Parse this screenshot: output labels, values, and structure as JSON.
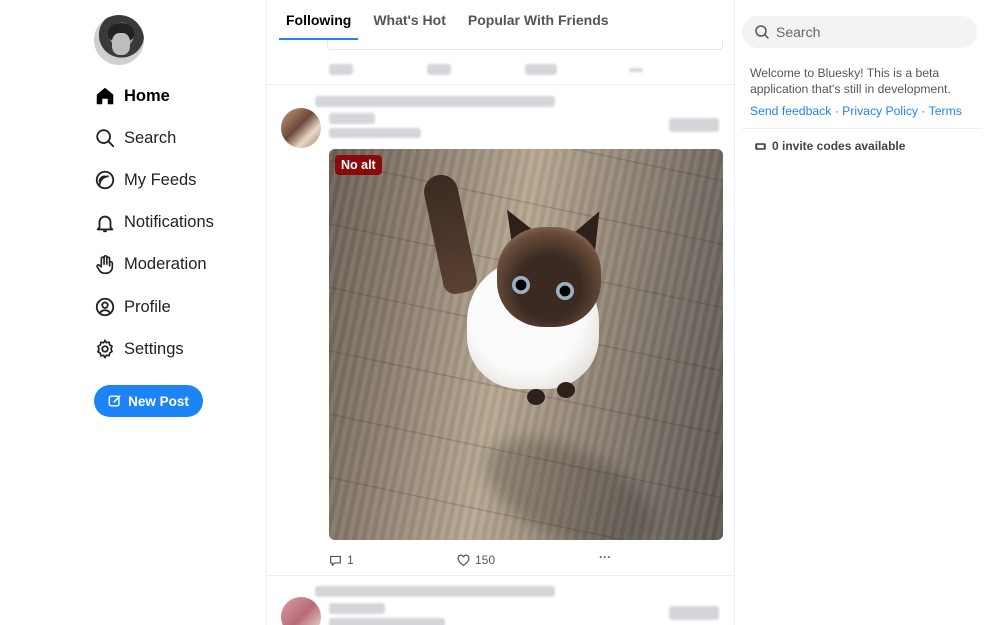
{
  "nav": {
    "items": [
      {
        "label": "Home",
        "icon": "home-icon"
      },
      {
        "label": "Search",
        "icon": "search-icon"
      },
      {
        "label": "My Feeds",
        "icon": "feeds-icon"
      },
      {
        "label": "Notifications",
        "icon": "bell-icon"
      },
      {
        "label": "Moderation",
        "icon": "hand-icon"
      },
      {
        "label": "Profile",
        "icon": "user-circle-icon"
      },
      {
        "label": "Settings",
        "icon": "gear-icon"
      }
    ],
    "new_post_label": "New Post"
  },
  "tabs": [
    {
      "label": "Following",
      "active": true
    },
    {
      "label": "What's Hot",
      "active": false
    },
    {
      "label": "Popular With Friends",
      "active": false
    }
  ],
  "post": {
    "badge": "No alt",
    "reply_count": "1",
    "like_count": "150",
    "more": "···"
  },
  "sidebar": {
    "search_placeholder": "Search",
    "welcome": "Welcome to Bluesky! This is a beta application that's still in development.",
    "links": [
      "Send feedback",
      "Privacy Policy",
      "Terms"
    ],
    "invites": "0 invite codes available"
  },
  "colors": {
    "accent": "#1d84f5",
    "badge_bg": "#8a0a0a"
  }
}
